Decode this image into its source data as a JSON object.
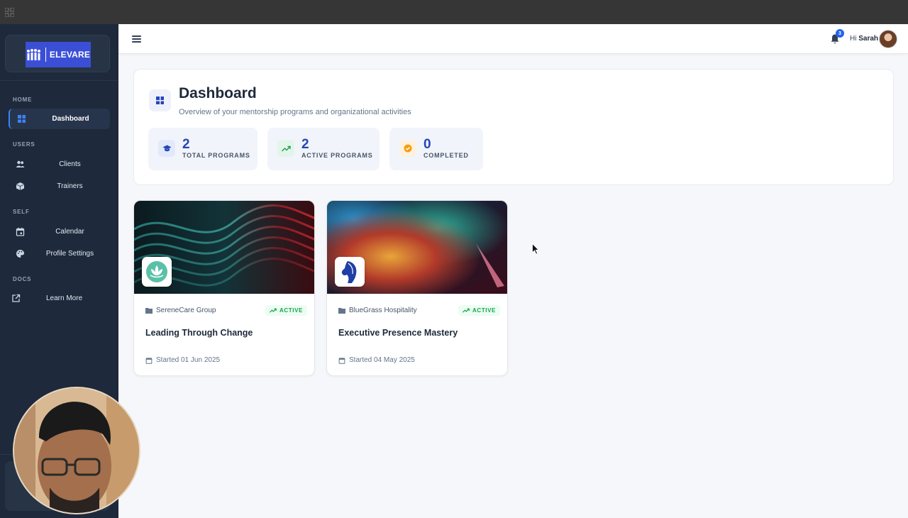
{
  "app": {
    "logo_text": "ELEVARE"
  },
  "sidebar": {
    "sections": {
      "home": "HOME",
      "users": "USERS",
      "self": "SELF",
      "docs": "DOCS"
    },
    "items": {
      "dashboard": "Dashboard",
      "clients": "Clients",
      "trainers": "Trainers",
      "calendar": "Calendar",
      "profile_settings": "Profile Settings",
      "learn_more": "Learn More"
    },
    "active": "dashboard"
  },
  "header": {
    "notification_count": "3",
    "greeting_prefix": "Hi",
    "user_name": "Sarah"
  },
  "dashboard": {
    "title": "Dashboard",
    "subtitle": "Overview of your mentorship programs and organizational activities",
    "stats": [
      {
        "value": "2",
        "label": "TOTAL PROGRAMS",
        "icon": "graduation-cap-icon"
      },
      {
        "value": "2",
        "label": "ACTIVE PROGRAMS",
        "icon": "trending-up-icon"
      },
      {
        "value": "0",
        "label": "COMPLETED",
        "icon": "check-circle-icon"
      }
    ]
  },
  "programs": [
    {
      "organization": "SereneCare Group",
      "status": "ACTIVE",
      "title": "Leading Through Change",
      "started": "Started 01 Jun 2025",
      "logo_icon": "lotus-icon"
    },
    {
      "organization": "BlueGrass Hospitality",
      "status": "ACTIVE",
      "title": "Executive Presence Mastery",
      "started": "Started 04 May 2025",
      "logo_icon": "horse-head-icon"
    }
  ],
  "colors": {
    "sidebar_bg": "#1e293b",
    "accent": "#2445b8",
    "active_green": "#16a34a",
    "logo_blue": "#3b4fd6"
  }
}
